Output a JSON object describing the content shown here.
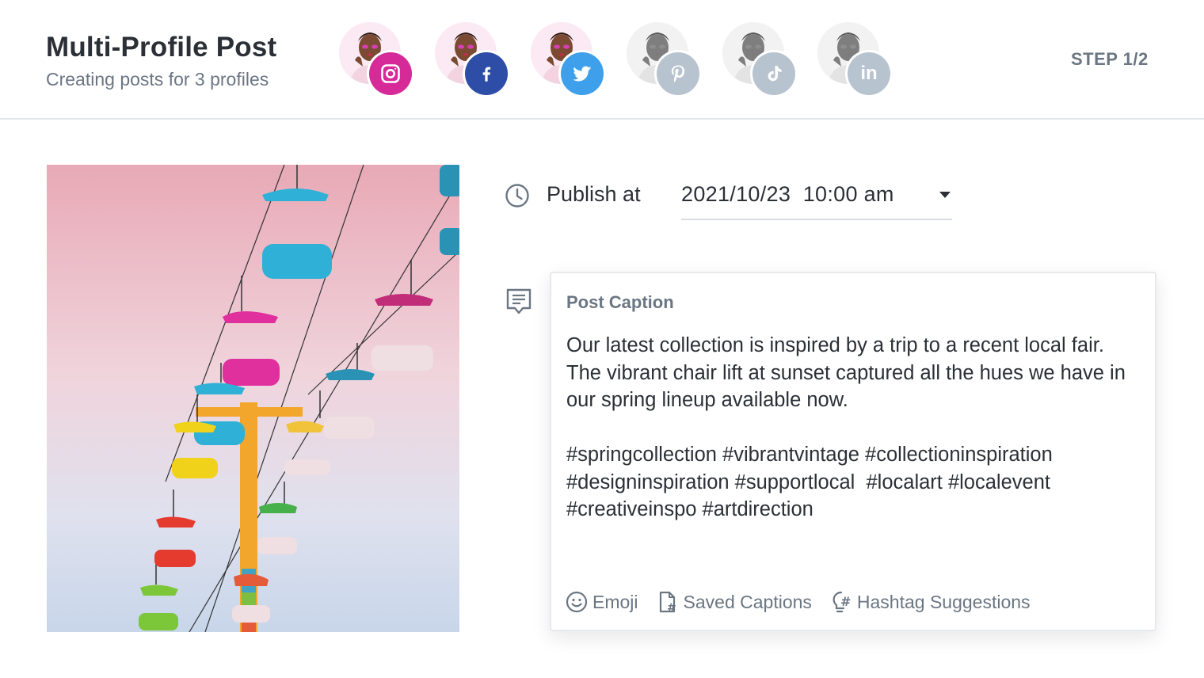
{
  "header": {
    "title": "Multi-Profile Post",
    "subtitle": "Creating posts for 3 profiles",
    "step": "STEP 1/2"
  },
  "profiles": [
    {
      "network": "Instagram",
      "icon": "instagram-icon",
      "color": "#d62a99",
      "selected": true
    },
    {
      "network": "Facebook",
      "icon": "facebook-icon",
      "color": "#2d4da6",
      "selected": true
    },
    {
      "network": "Twitter",
      "icon": "twitter-icon",
      "color": "#3ea0ea",
      "selected": true
    },
    {
      "network": "Pinterest",
      "icon": "pinterest-icon",
      "color": "#b8c3d0",
      "selected": false
    },
    {
      "network": "TikTok",
      "icon": "tiktok-icon",
      "color": "#b8c3d0",
      "selected": false
    },
    {
      "network": "LinkedIn",
      "icon": "linkedin-icon",
      "color": "#b8c3d0",
      "selected": false
    }
  ],
  "schedule": {
    "label": "Publish at",
    "value": "2021/10/23  10:00 am"
  },
  "caption": {
    "label": "Post Caption",
    "text": "Our latest collection is inspired by a trip to a recent local fair. The vibrant chair lift at sunset captured all the hues we have in our spring lineup available now.\n\n#springcollection #vibrantvintage #collectioninspiration #designinspiration #supportlocal  #localart #localevent #creativeinspo #artdirection",
    "tools": {
      "emoji": "Emoji",
      "saved": "Saved Captions",
      "hashtags": "Hashtag Suggestions"
    }
  },
  "colors": {
    "accent_gray": "#6b7683",
    "text": "#2b2f36",
    "inactive_badge": "#b8c3d0"
  }
}
